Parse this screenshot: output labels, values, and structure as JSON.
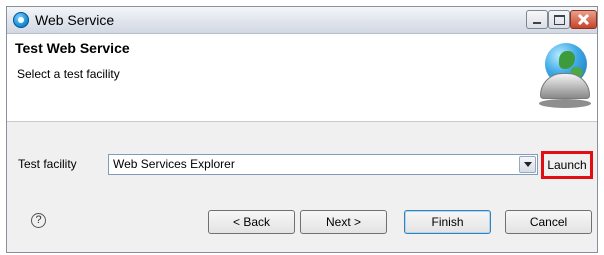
{
  "window": {
    "title": "Web Service",
    "icon": "web-service-icon",
    "controls": {
      "minimize": "minimize-icon",
      "maximize": "maximize-icon",
      "close": "close-icon"
    }
  },
  "header": {
    "title": "Test Web Service",
    "description": "Select a test facility",
    "image_icon": "globe-bell-icon"
  },
  "test_facility": {
    "label": "Test facility",
    "selected": "Web Services Explorer",
    "launch_label": "Launch",
    "highlight_color": "#e10e14"
  },
  "buttons": {
    "help_icon": "help-icon",
    "back": "< Back",
    "next": "Next >",
    "finish": "Finish",
    "cancel": "Cancel"
  }
}
